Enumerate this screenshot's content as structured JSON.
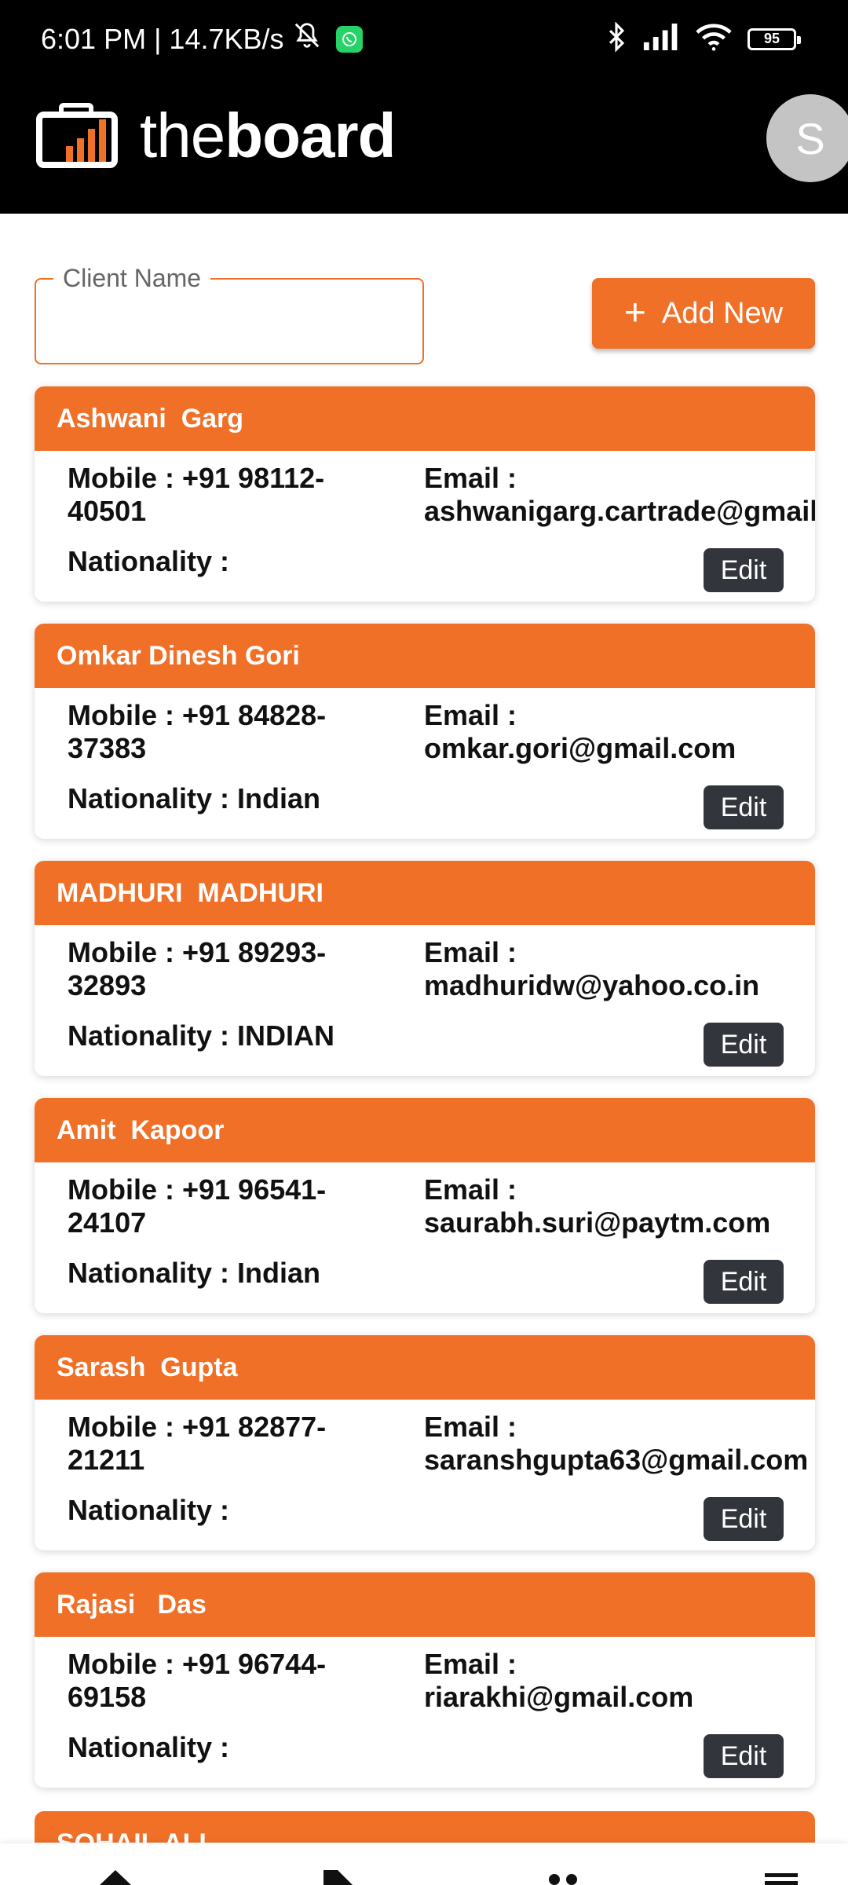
{
  "status_bar": {
    "time_speed": "6:01 PM | 14.7KB/s",
    "battery": "95"
  },
  "header": {
    "brand_light": "the",
    "brand_bold": "board",
    "avatar_initial": "S"
  },
  "search": {
    "label": "Client Name",
    "value": ""
  },
  "add_button_label": "Add New",
  "edit_label": "Edit",
  "clients": [
    {
      "name": "Ashwani  Garg",
      "mobile": "Mobile : +91 98112-40501",
      "email_label": "Email :",
      "email": "ashwanigarg.cartrade@gmail.c",
      "nationality": "Nationality :"
    },
    {
      "name": "Omkar Dinesh Gori",
      "mobile": "Mobile : +91 84828-37383",
      "email_label": "Email :",
      "email": "omkar.gori@gmail.com",
      "nationality": "Nationality : Indian"
    },
    {
      "name": "MADHURI  MADHURI",
      "mobile": "Mobile : +91 89293-32893",
      "email_label": "Email :",
      "email": "madhuridw@yahoo.co.in",
      "nationality": "Nationality : INDIAN"
    },
    {
      "name": "Amit  Kapoor",
      "mobile": "Mobile : +91 96541-24107",
      "email_label": "Email :",
      "email": "saurabh.suri@paytm.com",
      "nationality": "Nationality : Indian"
    },
    {
      "name": "Sarash  Gupta",
      "mobile": "Mobile : +91 82877-21211",
      "email_label": "Email :",
      "email": "saranshgupta63@gmail.com",
      "nationality": "Nationality :"
    },
    {
      "name": "Rajasi   Das",
      "mobile": "Mobile : +91 96744-69158",
      "email_label": "Email :",
      "email": "riarakhi@gmail.com",
      "nationality": "Nationality :"
    }
  ],
  "partial_client_name": "SOHAIL  ALI",
  "bottom_nav": [
    "home-icon",
    "tag-icon",
    "people-icon",
    "menu-icon"
  ],
  "colors": {
    "accent": "#F07028",
    "header_bg": "#000000",
    "edit_bg": "#32353C"
  }
}
